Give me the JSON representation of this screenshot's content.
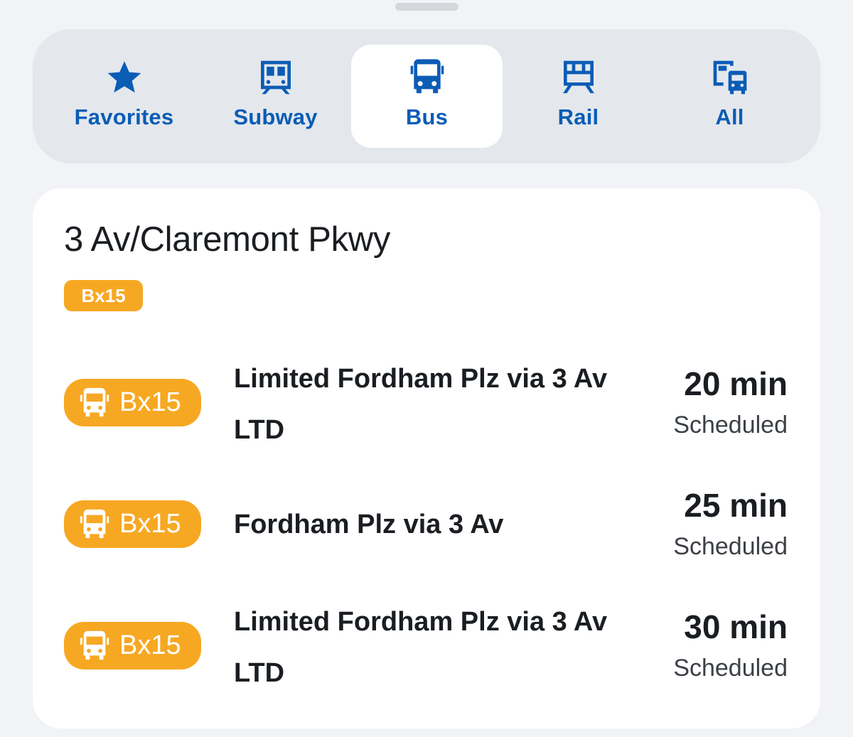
{
  "mode_tabs": [
    {
      "label": "Favorites",
      "icon": "star-icon"
    },
    {
      "label": "Subway",
      "icon": "subway-icon"
    },
    {
      "label": "Bus",
      "icon": "bus-icon",
      "active": true
    },
    {
      "label": "Rail",
      "icon": "rail-icon"
    },
    {
      "label": "All",
      "icon": "all-modes-icon"
    }
  ],
  "stop": {
    "name": "3 Av/Claremont Pkwy",
    "routes": [
      "Bx15"
    ]
  },
  "arrivals": [
    {
      "route": "Bx15",
      "headsign": "Limited Fordham Plz via 3 Av LTD",
      "eta": "20 min",
      "status": "Scheduled"
    },
    {
      "route": "Bx15",
      "headsign": "Fordham Plz via 3 Av",
      "eta": "25 min",
      "status": "Scheduled"
    },
    {
      "route": "Bx15",
      "headsign": "Limited Fordham Plz via 3 Av LTD",
      "eta": "30 min",
      "status": "Scheduled"
    }
  ],
  "colors": {
    "accent_blue": "#0b5cb5",
    "bus_orange": "#f7a823",
    "background": "#f1f3f6",
    "tab_bar": "#e4e8ed"
  }
}
